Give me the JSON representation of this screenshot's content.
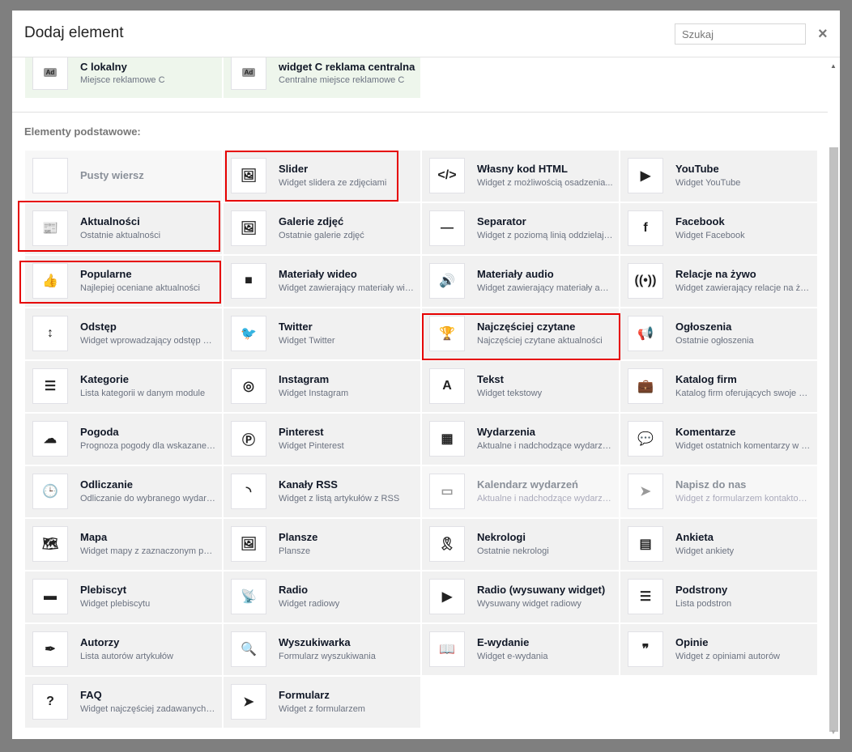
{
  "header": {
    "title": "Dodaj element",
    "search_placeholder": "Szukaj",
    "close": "×"
  },
  "ad_items": [
    {
      "title": "C lokalny",
      "desc": "Miejsce reklamowe C",
      "icon": "Ad"
    },
    {
      "title": "widget C reklama centralna",
      "desc": "Centralne miejsce reklamowe C",
      "icon": "Ad"
    }
  ],
  "section_label": "Elementy podstawowe:",
  "accent_highlight": "#e60000",
  "items": [
    {
      "title": "Pusty wiersz",
      "desc": "",
      "icon": "",
      "disabled": true
    },
    {
      "title": "Slider",
      "desc": "Widget slidera ze zdjęciami",
      "icon": "🖼",
      "highlight": true
    },
    {
      "title": "Własny kod HTML",
      "desc": "Widget z możliwością osadzenia...",
      "icon": "</>"
    },
    {
      "title": "YouTube",
      "desc": "Widget YouTube",
      "icon": "▶"
    },
    {
      "title": "Aktualności",
      "desc": "Ostatnie aktualności",
      "icon": "📰",
      "highlight": true
    },
    {
      "title": "Galerie zdjęć",
      "desc": "Ostatnie galerie zdjęć",
      "icon": "🖼"
    },
    {
      "title": "Separator",
      "desc": "Widget z poziomą linią oddzielającą",
      "icon": "—"
    },
    {
      "title": "Facebook",
      "desc": "Widget Facebook",
      "icon": "f"
    },
    {
      "title": "Popularne",
      "desc": "Najlepiej oceniane aktualności",
      "icon": "👍",
      "highlight": true
    },
    {
      "title": "Materiały wideo",
      "desc": "Widget zawierający materiały wideo",
      "icon": "■"
    },
    {
      "title": "Materiały audio",
      "desc": "Widget zawierający materiały audio",
      "icon": "🔊"
    },
    {
      "title": "Relacje na żywo",
      "desc": "Widget zawierający relacje na żywo",
      "icon": "((•))"
    },
    {
      "title": "Odstęp",
      "desc": "Widget wprowadzający odstęp między",
      "icon": "↕"
    },
    {
      "title": "Twitter",
      "desc": "Widget Twitter",
      "icon": "🐦"
    },
    {
      "title": "Najczęściej czytane",
      "desc": "Najczęściej czytane aktualności",
      "icon": "🏆",
      "highlight": true
    },
    {
      "title": "Ogłoszenia",
      "desc": "Ostatnie ogłoszenia",
      "icon": "📢"
    },
    {
      "title": "Kategorie",
      "desc": "Lista kategorii w danym module",
      "icon": "☰"
    },
    {
      "title": "Instagram",
      "desc": "Widget Instagram",
      "icon": "◎"
    },
    {
      "title": "Tekst",
      "desc": "Widget tekstowy",
      "icon": "A"
    },
    {
      "title": "Katalog firm",
      "desc": "Katalog firm oferujących swoje usługi",
      "icon": "💼"
    },
    {
      "title": "Pogoda",
      "desc": "Prognoza pogody dla wskazanej lokalizacji",
      "icon": "☁"
    },
    {
      "title": "Pinterest",
      "desc": "Widget Pinterest",
      "icon": "Ⓟ"
    },
    {
      "title": "Wydarzenia",
      "desc": "Aktualne i nadchodzące wydarzenia",
      "icon": "▦"
    },
    {
      "title": "Komentarze",
      "desc": "Widget ostatnich komentarzy w serwisie",
      "icon": "💬"
    },
    {
      "title": "Odliczanie",
      "desc": "Odliczanie do wybranego wydarzenia",
      "icon": "🕒"
    },
    {
      "title": "Kanały RSS",
      "desc": "Widget z listą artykułów z RSS",
      "icon": "◝"
    },
    {
      "title": "Kalendarz wydarzeń",
      "desc": "Aktualne i nadchodzące wydarzenia",
      "icon": "▭",
      "disabled": true
    },
    {
      "title": "Napisz do nas",
      "desc": "Widget z formularzem kontaktowym",
      "icon": "➤",
      "disabled": true
    },
    {
      "title": "Mapa",
      "desc": "Widget mapy z zaznaczonym punktem",
      "icon": "🗺"
    },
    {
      "title": "Plansze",
      "desc": "Plansze",
      "icon": "🖼"
    },
    {
      "title": "Nekrologi",
      "desc": "Ostatnie nekrologi",
      "icon": "🎗"
    },
    {
      "title": "Ankieta",
      "desc": "Widget ankiety",
      "icon": "▤"
    },
    {
      "title": "Plebiscyt",
      "desc": "Widget plebiscytu",
      "icon": "▬"
    },
    {
      "title": "Radio",
      "desc": "Widget radiowy",
      "icon": "📡"
    },
    {
      "title": "Radio (wysuwany widget)",
      "desc": "Wysuwany widget radiowy",
      "icon": "▶"
    },
    {
      "title": "Podstrony",
      "desc": "Lista podstron",
      "icon": "☰"
    },
    {
      "title": "Autorzy",
      "desc": "Lista autorów artykułów",
      "icon": "✒"
    },
    {
      "title": "Wyszukiwarka",
      "desc": "Formularz wyszukiwania",
      "icon": "🔍"
    },
    {
      "title": "E-wydanie",
      "desc": "Widget e-wydania",
      "icon": "📖"
    },
    {
      "title": "Opinie",
      "desc": "Widget z opiniami autorów",
      "icon": "❞"
    },
    {
      "title": "FAQ",
      "desc": "Widget najczęściej zadawanych pytań",
      "icon": "?"
    },
    {
      "title": "Formularz",
      "desc": "Widget z formularzem",
      "icon": "➤"
    }
  ]
}
